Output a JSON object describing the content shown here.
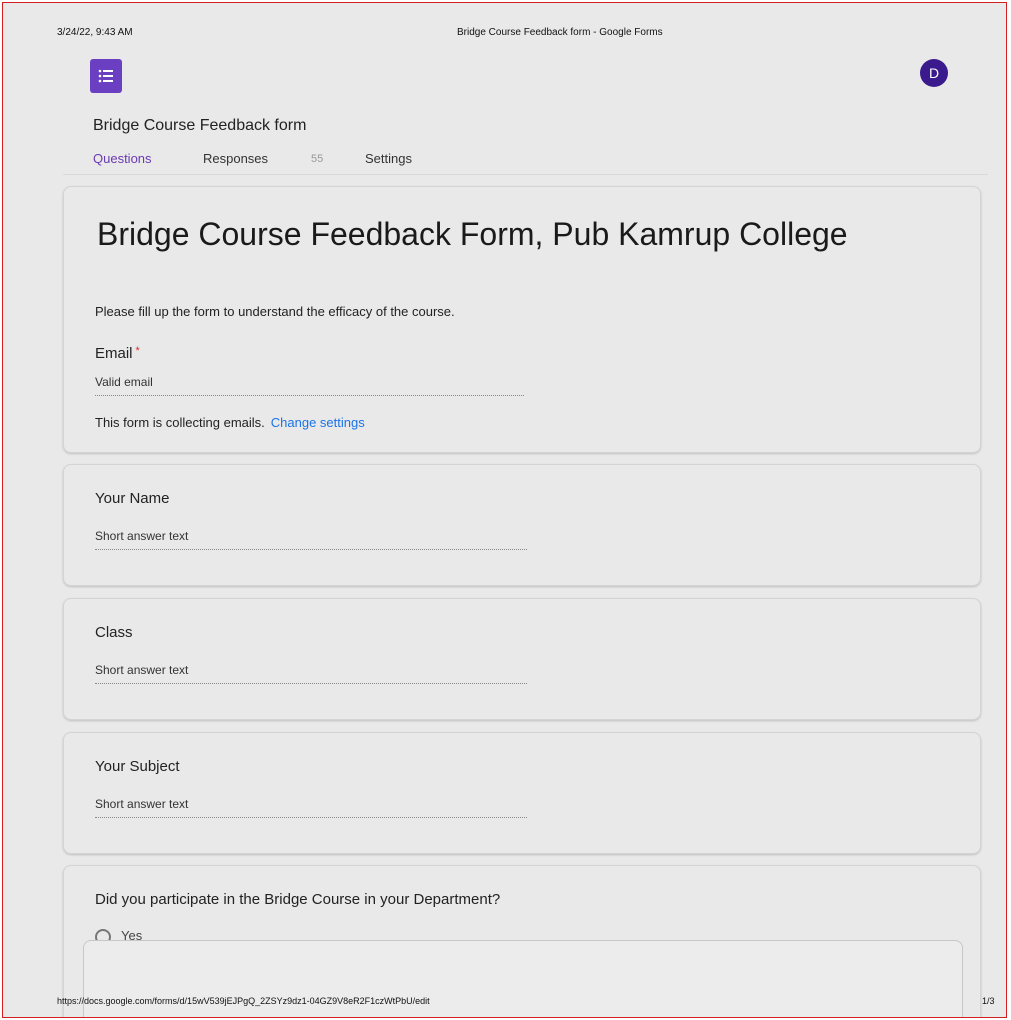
{
  "print_header": {
    "datetime": "3/24/22, 9:43 AM",
    "page_title": "Bridge Course Feedback form - Google Forms"
  },
  "app": {
    "logo_icon": "google-forms-icon",
    "logo_color": "#6b3fc2",
    "avatar_letter": "D",
    "avatar_color": "#3b1a8e",
    "form_name": "Bridge Course Feedback form"
  },
  "tabs": {
    "questions": "Questions",
    "responses": "Responses",
    "responses_count": "55",
    "settings": "Settings",
    "active_color": "#6a3ab2"
  },
  "header_card": {
    "title": "Bridge Course Feedback Form, Pub Kamrup College",
    "description": "Please fill up the form to understand the efficacy of the course.",
    "email_label": "Email",
    "required_marker": "*",
    "email_placeholder": "Valid email",
    "collecting_note": "This form is collecting emails.",
    "change_settings": "Change settings",
    "link_color": "#1a73e8"
  },
  "questions": [
    {
      "label": "Your Name",
      "placeholder": "Short answer text"
    },
    {
      "label": "Class",
      "placeholder": "Short answer text"
    },
    {
      "label": "Your Subject",
      "placeholder": "Short answer text"
    },
    {
      "label": "Did you participate in the Bridge Course in your Department?",
      "option": "Yes"
    }
  ],
  "print_footer": {
    "url": "https://docs.google.com/forms/d/15wV539jEJPgQ_2ZSYz9dz1-04GZ9V8eR2F1czWtPbU/edit",
    "page": "1/3"
  }
}
